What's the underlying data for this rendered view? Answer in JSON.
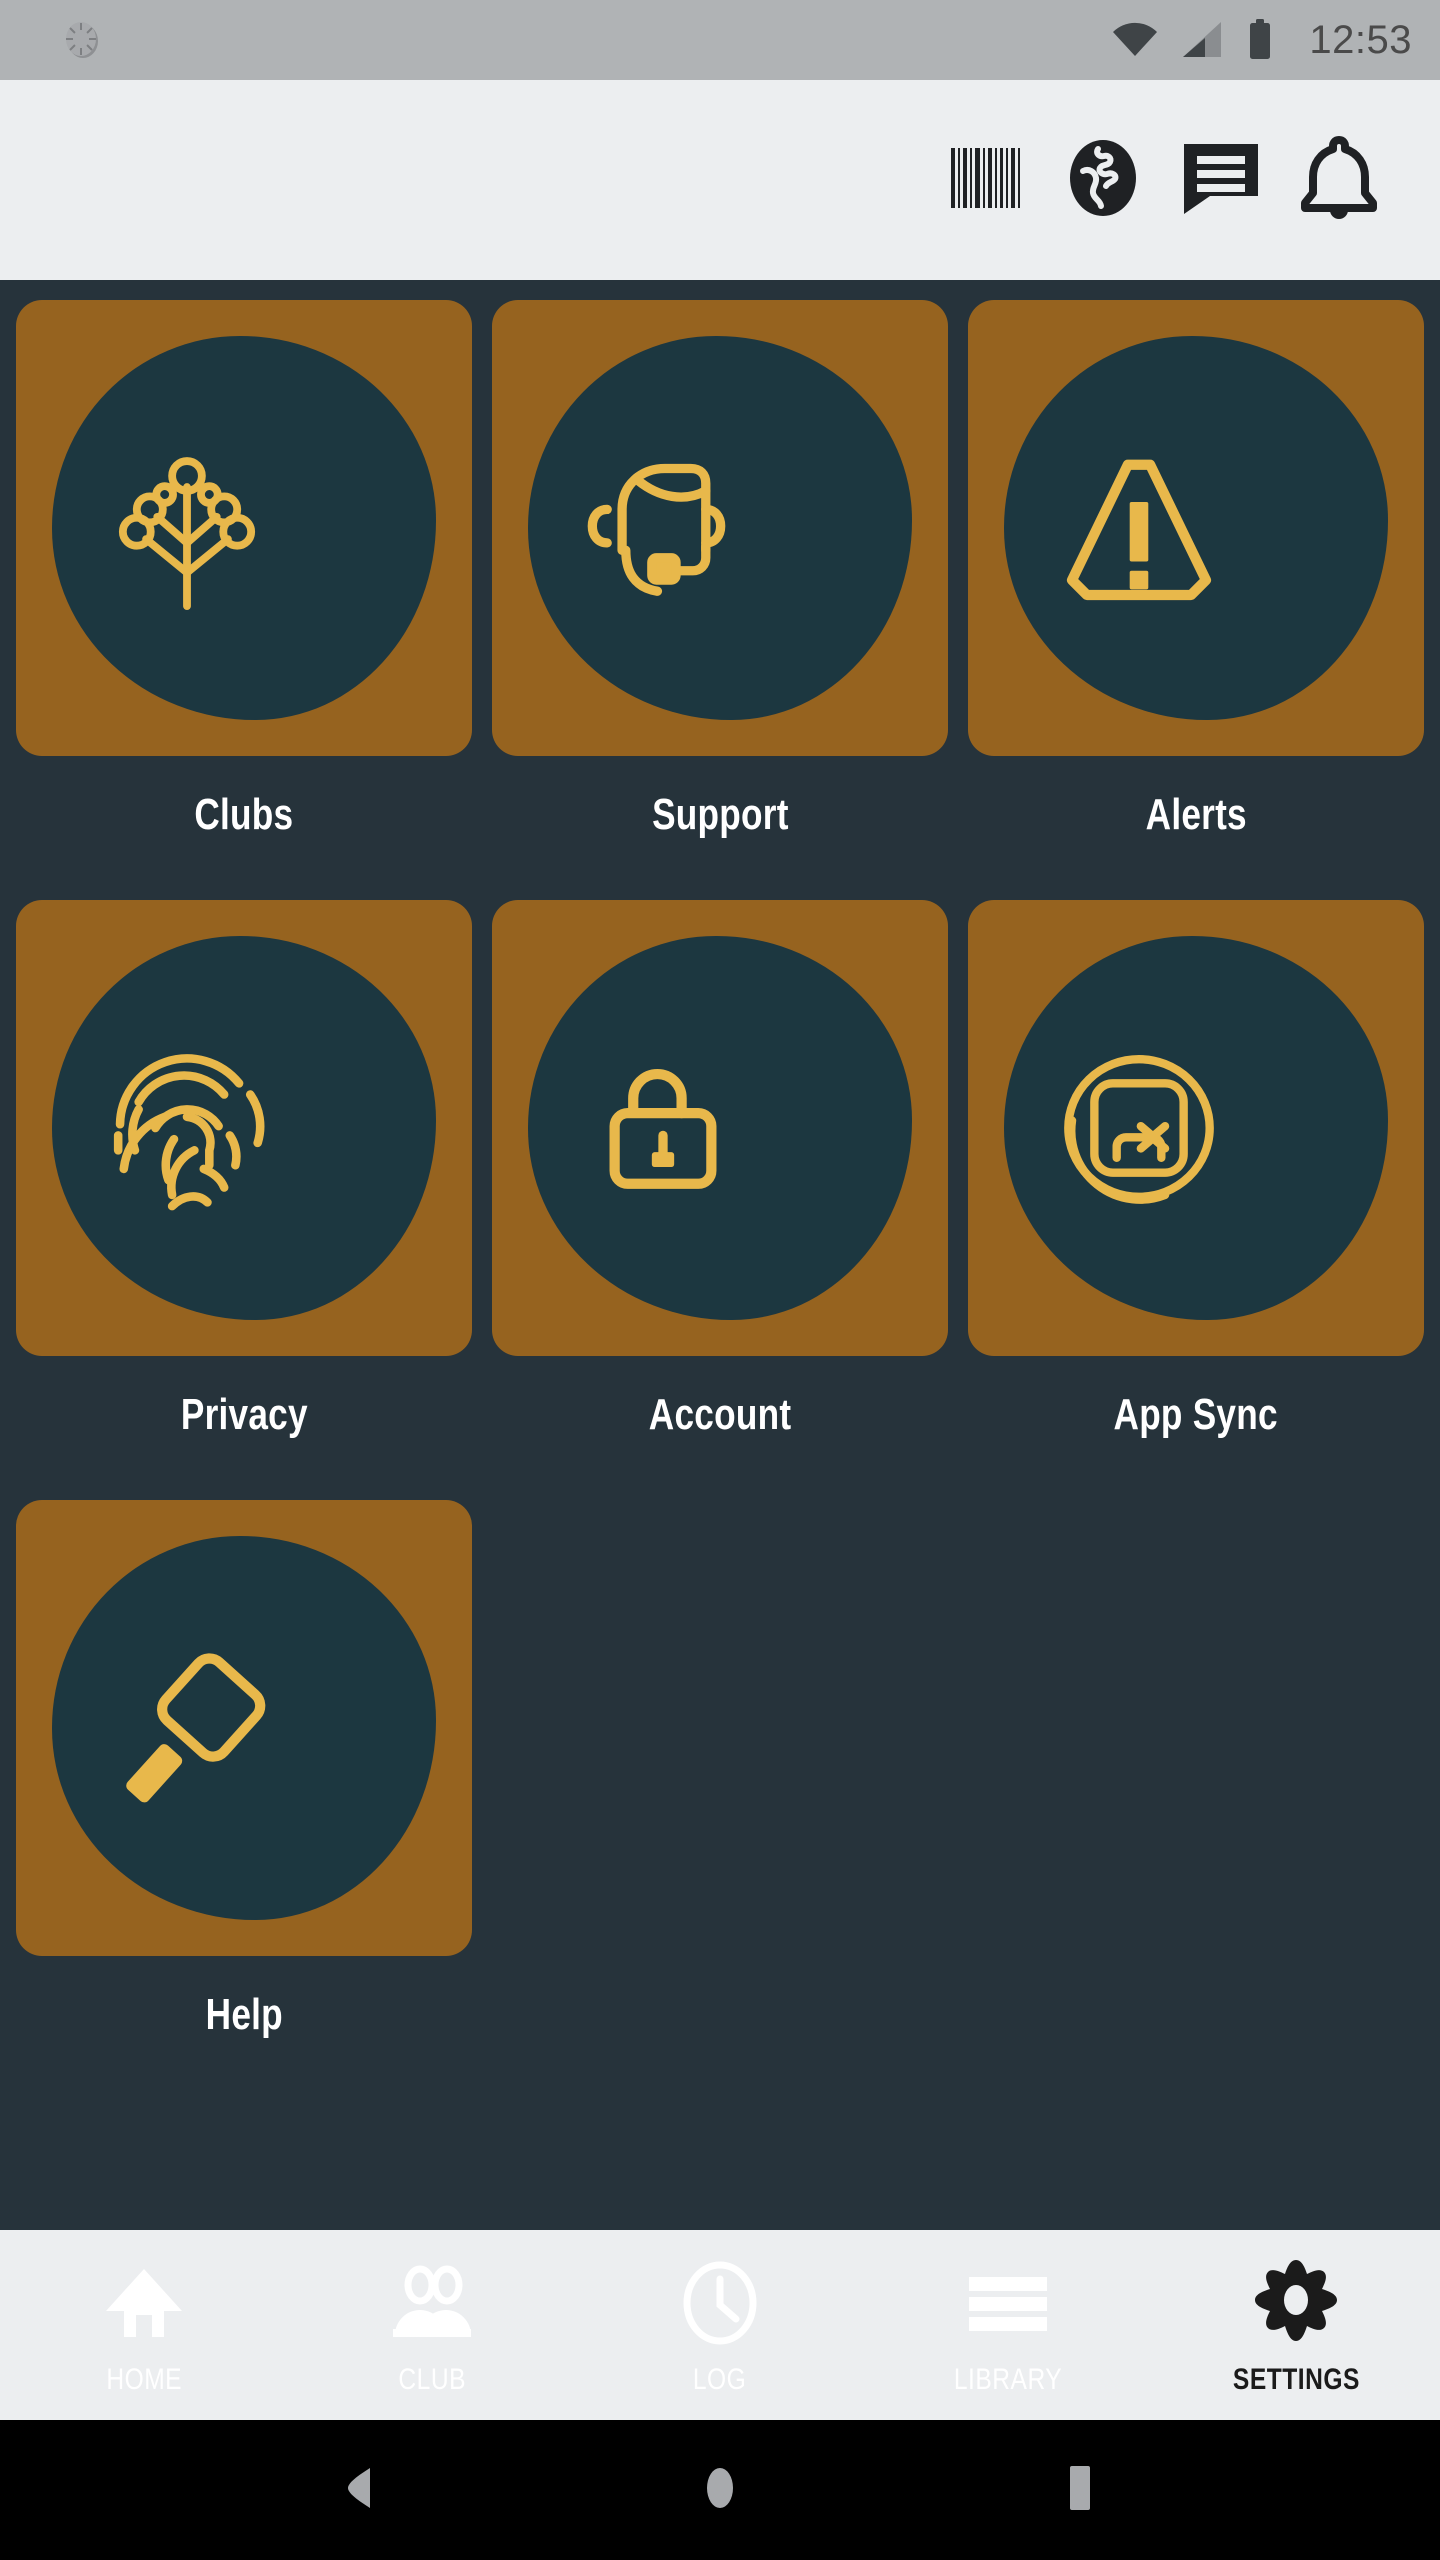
{
  "status_bar": {
    "clock": "12:53",
    "icons": [
      "brightness-dial-icon",
      "wifi-icon",
      "cellular-signal-icon",
      "battery-icon"
    ]
  },
  "app_toolbar": {
    "buttons": [
      {
        "name": "barcode-scanner",
        "label": "Barcode"
      },
      {
        "name": "globe",
        "label": "Globe"
      },
      {
        "name": "messages",
        "label": "Messages"
      },
      {
        "name": "notifications",
        "label": "Notifications"
      }
    ]
  },
  "grid": {
    "items": [
      {
        "label": "Clubs",
        "icon": "tree-network-icon"
      },
      {
        "label": "Support",
        "icon": "headset-agent-icon"
      },
      {
        "label": "Alerts",
        "icon": "warning-triangle-icon"
      },
      {
        "label": "Privacy",
        "icon": "fingerprint-icon"
      },
      {
        "label": "Account",
        "icon": "open-padlock-icon"
      },
      {
        "label": "App Sync",
        "icon": "sync-arrows-icon"
      },
      {
        "label": "Help",
        "icon": "magnifier-icon"
      }
    ]
  },
  "bottom_nav": {
    "items": [
      {
        "label": "HOME",
        "icon": "house-icon",
        "active": false
      },
      {
        "label": "CLUB",
        "icon": "people-icon",
        "active": false
      },
      {
        "label": "LOG",
        "icon": "clock-icon",
        "active": false
      },
      {
        "label": "LIBRARY",
        "icon": "list-lines-icon",
        "active": false
      },
      {
        "label": "SETTINGS",
        "icon": "gear-icon",
        "active": true
      }
    ]
  },
  "android_nav": {
    "buttons": [
      "back-triangle-icon",
      "home-circle-icon",
      "recents-square-icon"
    ]
  },
  "colors": {
    "tile_bronze": "#96631f",
    "tile_disc_dark": "#1c3740",
    "accent_gold": "#e8b84b",
    "content_bg": "#26333b",
    "toolbar_bg": "#eceef0",
    "status_bg": "#b0b3b5"
  }
}
